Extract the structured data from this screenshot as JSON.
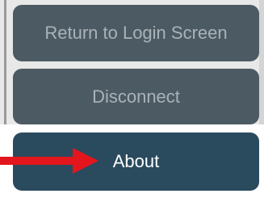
{
  "menu": {
    "return_label": "Return to Login Screen",
    "disconnect_label": "Disconnect",
    "about_label": "About"
  },
  "annotation": {
    "arrow_icon": "red-right-arrow-icon",
    "arrow_color": "#e3161d"
  },
  "colors": {
    "inactive_button": "#4c5b63",
    "active_button": "#2a4a5e"
  }
}
